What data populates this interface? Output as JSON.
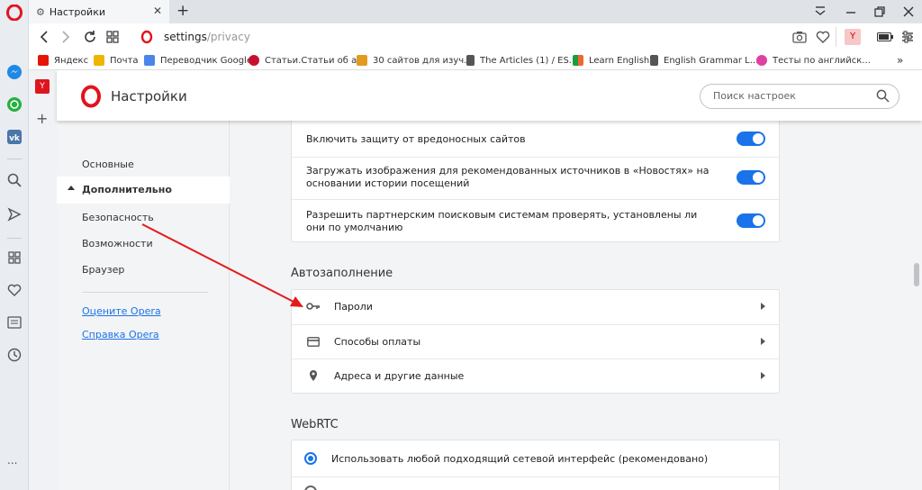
{
  "window": {
    "tab_title": "Настройки",
    "new_tab": "+"
  },
  "address": {
    "url_main": "settings",
    "url_path": "/privacy"
  },
  "bookmarks": [
    {
      "label": "Яндекс",
      "color": "#e61400"
    },
    {
      "label": "Почта",
      "color": "#f0b400"
    },
    {
      "label": "Переводчик Google",
      "color": "#4a86e8"
    },
    {
      "label": "Статьи.Статьи об а...",
      "color": "#c8102e"
    },
    {
      "label": "30 сайтов для изуч...",
      "color": "#e39b1e"
    },
    {
      "label": "The Articles (1) / ES...",
      "color": "#555555"
    },
    {
      "label": "Learn English",
      "color": "#1a9c3e"
    },
    {
      "label": "English Grammar L...",
      "color": "#555555"
    },
    {
      "label": "Тесты по английск...",
      "color": "#e040a0"
    }
  ],
  "bookmarks_more": "»",
  "header": {
    "title": "Настройки",
    "search_placeholder": "Поиск настроек"
  },
  "nav": {
    "basic": "Основные",
    "advanced": "Дополнительно",
    "security": "Безопасность",
    "features": "Возможности",
    "browser": "Браузер",
    "rate": "Оцените Opera",
    "help": "Справка Opera"
  },
  "privacy": [
    {
      "text": "Включить защиту от вредоносных сайтов",
      "on": true
    },
    {
      "text": "Загружать изображения для рекомендованных источников в «Новостях» на основании истории посещений",
      "on": true
    },
    {
      "text": "Разрешить партнерским поисковым системам проверять, установлены ли они по умолчанию",
      "on": true
    }
  ],
  "autofill": {
    "title": "Автозаполнение",
    "items": [
      "Пароли",
      "Способы оплаты",
      "Адреса и другие данные"
    ]
  },
  "webrtc": {
    "title": "WebRTC",
    "option1": "Использовать любой подходящий сетевой интерфейс (рекомендовано)"
  },
  "colors": {
    "accent": "#1a73e8",
    "opera_red": "#e0141e",
    "arrow": "#e41b1b"
  },
  "sidebar_more": "..."
}
